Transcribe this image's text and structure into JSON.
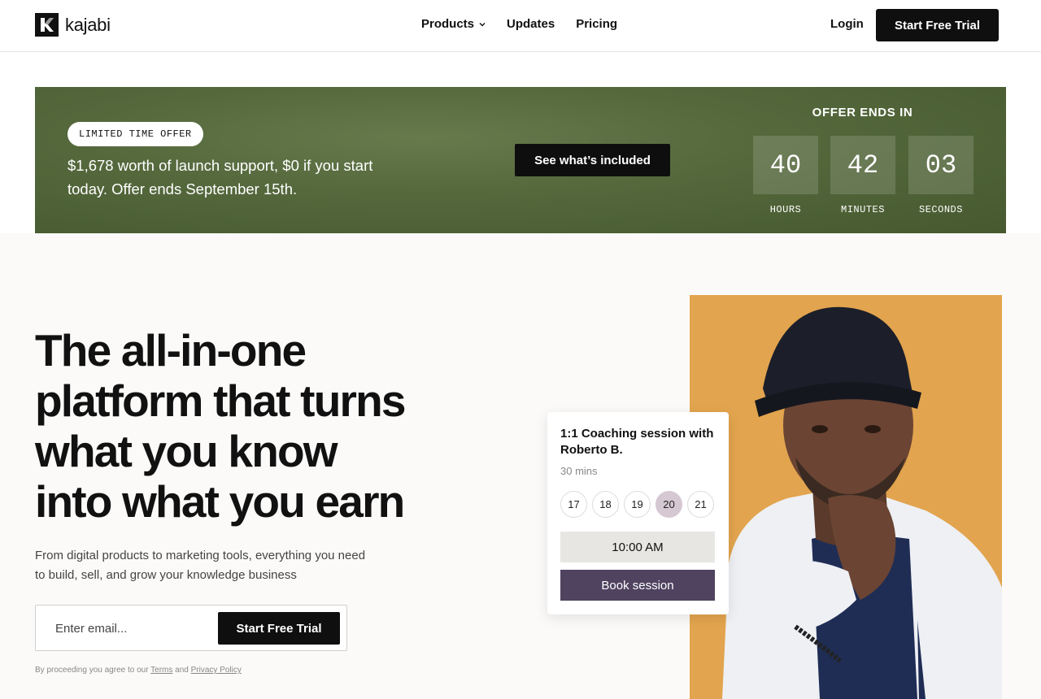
{
  "header": {
    "logo_text": "kajabi",
    "nav": [
      {
        "label": "Products",
        "has_dropdown": true
      },
      {
        "label": "Updates",
        "has_dropdown": false
      },
      {
        "label": "Pricing",
        "has_dropdown": false
      }
    ],
    "login_label": "Login",
    "trial_label": "Start Free Trial"
  },
  "banner": {
    "badge": "LIMITED TIME OFFER",
    "text": "$1,678 worth of launch support, $0 if you start today. Offer ends September 15th.",
    "button_label": "See what’s included",
    "countdown_title": "OFFER ENDS IN",
    "countdown": [
      {
        "value": "40",
        "label": "HOURS"
      },
      {
        "value": "42",
        "label": "MINUTES"
      },
      {
        "value": "03",
        "label": "SECONDS"
      }
    ],
    "colors": {
      "background": "#55693d"
    }
  },
  "hero": {
    "headline_lines": [
      "The all-in-one",
      "platform that turns",
      "what you know",
      "into what you earn"
    ],
    "subtext": "From digital products to marketing tools, everything you need to build, sell, and grow your knowledge business",
    "email_placeholder": "Enter email...",
    "trial_label": "Start Free Trial",
    "legal_prefix": "By proceeding you agree to our",
    "legal_terms": "Terms",
    "legal_and": "and",
    "legal_privacy": "Privacy Policy"
  },
  "booking_card": {
    "title": "1:1 Coaching session with Roberto B.",
    "duration": "30 mins",
    "dates": [
      "17",
      "18",
      "19",
      "20",
      "21"
    ],
    "selected_date": "20",
    "time": "10:00 AM",
    "book_label": "Book session",
    "colors": {
      "book_button": "#4f4360",
      "selected_date": "#d6c8d2"
    }
  },
  "photo": {
    "icon": "person-photo",
    "background": "#e2a44e"
  }
}
